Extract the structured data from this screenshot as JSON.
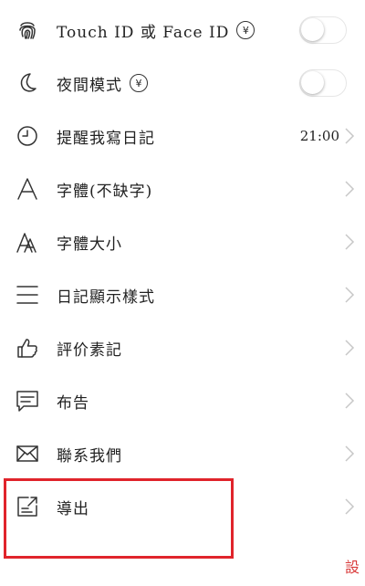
{
  "settings": {
    "items": [
      {
        "label": "Touch ID 或 Face ID",
        "premium_badge": "¥",
        "control": "toggle",
        "enabled": false
      },
      {
        "label": "夜間模式",
        "premium_badge": "¥",
        "control": "toggle",
        "enabled": false
      },
      {
        "label": "提醒我寫日記",
        "value": "21:00"
      },
      {
        "label": "字體(不缺字)"
      },
      {
        "label": "字體大小"
      },
      {
        "label": "日記顯示樣式"
      },
      {
        "label": "評价素記"
      },
      {
        "label": "布告"
      },
      {
        "label": "聯系我們"
      },
      {
        "label": "導出"
      }
    ]
  },
  "footer": {
    "corner_text": "設"
  },
  "icons": [
    "fingerprint-icon",
    "moon-icon",
    "clock-icon",
    "font-icon",
    "font-size-icon",
    "list-style-icon",
    "thumbs-up-icon",
    "message-icon",
    "mail-icon",
    "export-icon"
  ],
  "colors": {
    "highlight": "#e0242b",
    "chevron": "#c7c7c7"
  }
}
